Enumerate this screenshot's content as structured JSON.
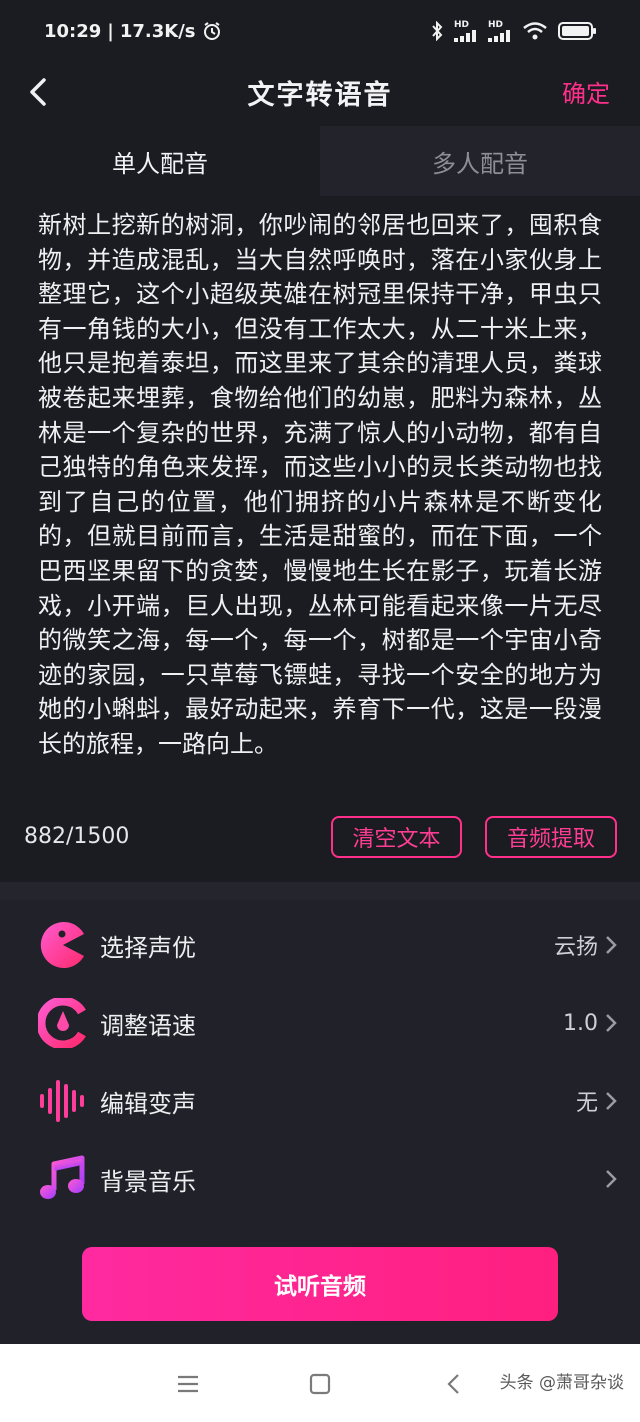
{
  "status_bar": {
    "time": "10:29",
    "separator": "|",
    "speed": "17.3K/s",
    "hd_label_1": "HD",
    "hd_label_2": "HD",
    "icons": [
      "alarm-icon",
      "bluetooth-icon",
      "signal-icon",
      "signal-icon",
      "wifi-icon",
      "battery-icon"
    ]
  },
  "header": {
    "title": "文字转语音",
    "confirm_label": "确定",
    "icons": [
      "back-icon"
    ]
  },
  "tabs": [
    {
      "label": "单人配音",
      "active": true
    },
    {
      "label": "多人配音",
      "active": false
    }
  ],
  "editor": {
    "text": "新树上挖新的树洞，你吵闹的邻居也回来了，囤积食物，并造成混乱，当大自然呼唤时，落在小家伙身上整理它，这个小超级英雄在树冠里保持干净，甲虫只有一角钱的大小，但没有工作太大，从二十米上来，他只是抱着泰坦，而这里来了其余的清理人员，粪球被卷起来埋葬，食物给他们的幼崽，肥料为森林，丛林是一个复杂的世界，充满了惊人的小动物，都有自己独特的角色来发挥，而这些小小的灵长类动物也找到了自己的位置，他们拥挤的小片森林是不断变化的，但就目前而言，生活是甜蜜的，而在下面，一个巴西坚果留下的贪婪，慢慢地生长在影子，玩着长游戏，小开端，巨人出现，丛林可能看起来像一片无尽的微笑之海，每一个，每一个，树都是一个宇宙小奇迹的家园，一只草莓飞镖蛙，寻找一个安全的地方为她的小蝌蚪，最好动起来，养育下一代，这是一段漫长的旅程，一路向上。",
    "counter": "882/1500",
    "clear_label": "清空文本",
    "extract_label": "音频提取"
  },
  "settings": [
    {
      "label": "选择声优",
      "value": "云扬",
      "icon": "voice-actor-icon"
    },
    {
      "label": "调整语速",
      "value": "1.0",
      "icon": "speed-icon"
    },
    {
      "label": "编辑变声",
      "value": "无",
      "icon": "waveform-icon"
    },
    {
      "label": "背景音乐",
      "value": "",
      "icon": "music-note-icon"
    }
  ],
  "cta_label": "试听音频",
  "navbar": {
    "icons": [
      "menu-icon",
      "home-square-icon",
      "back-triangle-icon"
    ],
    "watermark": "头条 @萧哥杂谈"
  },
  "colors": {
    "accent": "#ff2f8a",
    "background": "#1b1c22",
    "panel": "#202129"
  }
}
